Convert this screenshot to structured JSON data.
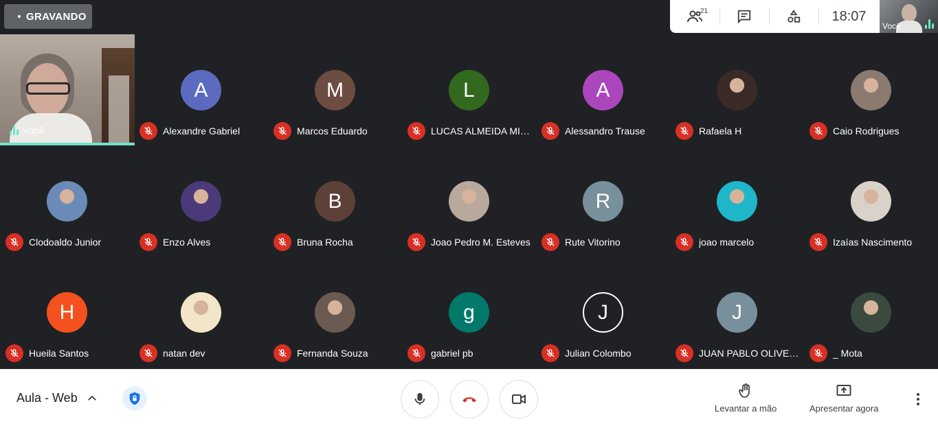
{
  "recording": {
    "label": "GRAVANDO"
  },
  "top_panel": {
    "participants_count": "21",
    "clock": "18:07"
  },
  "self_preview": {
    "label": "Você"
  },
  "self_tile": {
    "label": "Você"
  },
  "colors": {
    "accent": "#6ee4cb",
    "muted": "#d93025",
    "background": "#202124"
  },
  "participants": [
    {
      "name": "Alexandre Gabriel",
      "initial": "A",
      "color": "#5c6bc0"
    },
    {
      "name": "Marcos Eduardo",
      "initial": "M",
      "color": "#6d4c41"
    },
    {
      "name": "LUCAS ALMEIDA MIO…",
      "initial": "L",
      "color": "#33691e"
    },
    {
      "name": "Alessandro Trause",
      "initial": "A",
      "color": "#ab47bc"
    },
    {
      "name": "Rafaela H",
      "initial": "",
      "color": "#3a2a28"
    },
    {
      "name": "Caio Rodrigues",
      "initial": "",
      "color": "#8a7a70"
    },
    {
      "name": "Clodoaldo Junior",
      "initial": "",
      "color": "#6a8bb8"
    },
    {
      "name": "Enzo Alves",
      "initial": "",
      "color": "#4a3a7a"
    },
    {
      "name": "Bruna Rocha",
      "initial": "B",
      "color": "#5d4037"
    },
    {
      "name": "Joao Pedro M. Esteves",
      "initial": "",
      "color": "#b9a99c"
    },
    {
      "name": "Rute Vitorino",
      "initial": "R",
      "color": "#78909c"
    },
    {
      "name": "joao marcelo",
      "initial": "",
      "color": "#1fb6c9"
    },
    {
      "name": "Izaías Nascimento",
      "initial": "",
      "color": "#d9d2c8"
    },
    {
      "name": "Hueila Santos",
      "initial": "H",
      "color": "#f4511e"
    },
    {
      "name": "natan dev",
      "initial": "",
      "color": "#f3e6c8"
    },
    {
      "name": "Fernanda Souza",
      "initial": "",
      "color": "#6b5a52"
    },
    {
      "name": "gabriel pb",
      "initial": "g",
      "color": "#00796b"
    },
    {
      "name": "Julian Colombo",
      "initial": "J",
      "color": "#202124"
    },
    {
      "name": "JUAN PABLO OLIVEI…",
      "initial": "J",
      "color": "#78909c"
    },
    {
      "name": "_ Mota",
      "initial": "",
      "color": "#3b4a3e"
    }
  ],
  "bottom": {
    "meeting_title": "Aula - Web",
    "raise_hand": "Levantar a mão",
    "present_now": "Apresentar agora"
  }
}
